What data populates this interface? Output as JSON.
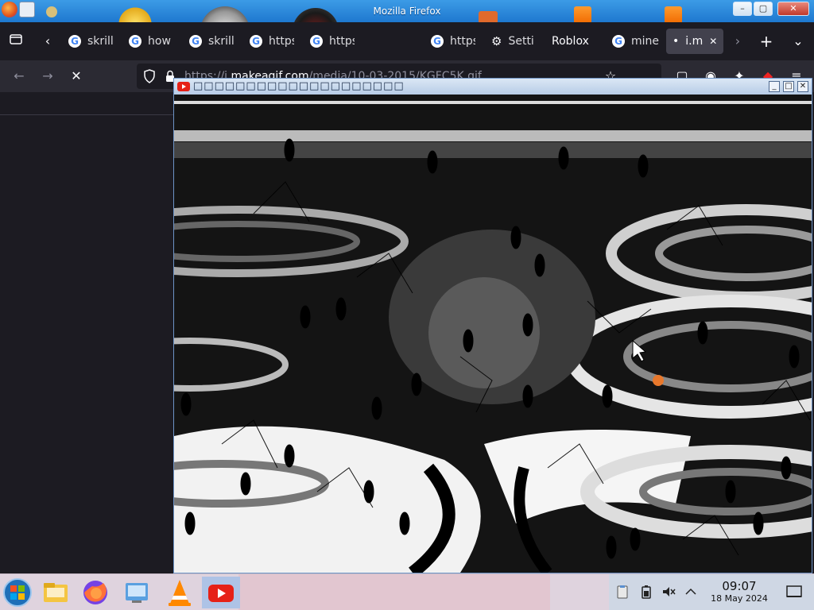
{
  "os_window": {
    "title": "Mozilla Firefox",
    "buttons": [
      "–",
      "▢",
      "✕"
    ]
  },
  "tabs": [
    {
      "label": "skrill",
      "icon": "google-icon"
    },
    {
      "label": "how",
      "icon": "google-icon"
    },
    {
      "label": "skrill",
      "icon": "google-icon"
    },
    {
      "label": "https",
      "icon": "google-icon"
    },
    {
      "label": "https",
      "icon": "google-icon"
    },
    {
      "label": "https",
      "icon": "google-icon"
    },
    {
      "label": "Setti",
      "icon": "gear-icon"
    },
    {
      "label": "Roblox",
      "icon": ""
    },
    {
      "label": "mine",
      "icon": "google-icon"
    },
    {
      "label": "i.m",
      "icon": "dot-icon",
      "active": true
    }
  ],
  "toolbar": {
    "list_all_tabs": "⌄",
    "new_tab": "+",
    "scroll_left": "‹",
    "scroll_right": "›",
    "back": "←",
    "forward": "→",
    "stop": "✕"
  },
  "urlbar": {
    "url_prefix": "https://i.",
    "url_domain": "makeagif.com",
    "url_path": "/media/10-03-2015/KGFC5K.gif"
  },
  "floating_window": {
    "title": "□□□□□□□□□□□□□□□□□□□□",
    "buttons": [
      "_",
      "□",
      "✕"
    ]
  },
  "taskbar": {
    "apps": [
      "start-orb",
      "file-explorer",
      "firefox",
      "control-panel",
      "vlc",
      "youtube"
    ],
    "clock": {
      "time": "09:07",
      "date": "18 May 2024"
    }
  },
  "colors": {
    "titlebar": "#1e78cf",
    "tab_strip": "#1c1b22",
    "nav_bar": "#2b2a33",
    "taskbar": "#dfd3de",
    "youtube_red": "#e62117"
  }
}
